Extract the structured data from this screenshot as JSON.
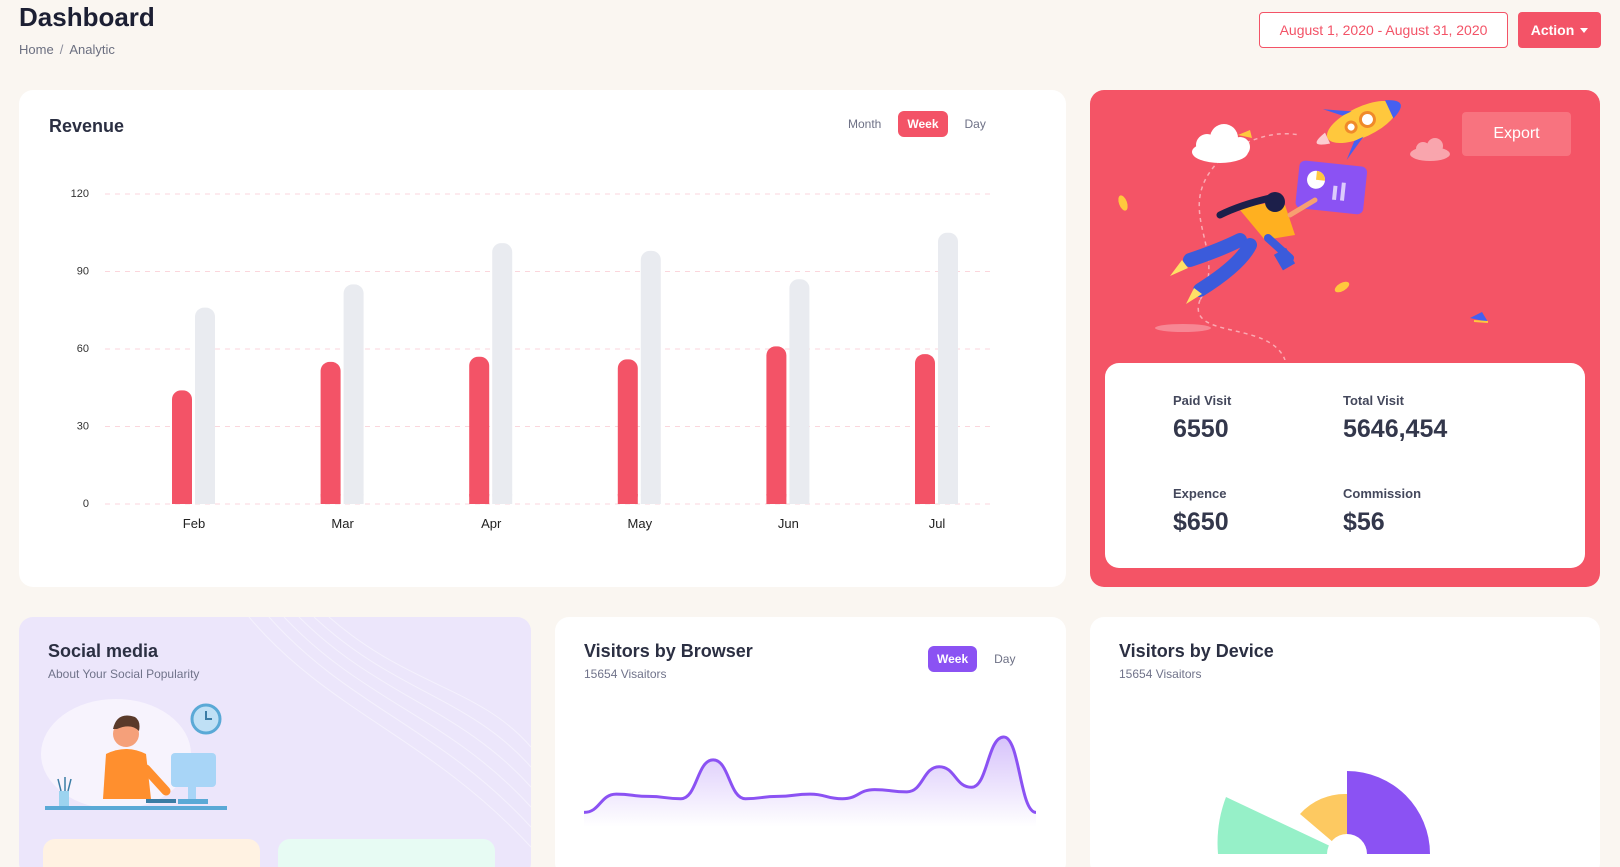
{
  "header": {
    "title": "Dashboard",
    "breadcrumb": [
      "Home",
      "Analytic"
    ],
    "breadcrumb_sep": "/",
    "date_range": "August 1, 2020 - August 31, 2020",
    "action_label": "Action"
  },
  "revenue": {
    "title": "Revenue",
    "tabs": [
      "Month",
      "Week",
      "Day"
    ],
    "active_tab": "Week"
  },
  "promo": {
    "export_label": "Export",
    "stats": [
      {
        "label": "Paid Visit",
        "value": "6550"
      },
      {
        "label": "Total Visit",
        "value": "5646,454"
      },
      {
        "label": "Expence",
        "value": "$650"
      },
      {
        "label": "Commission",
        "value": "$56"
      }
    ]
  },
  "social": {
    "title": "Social media",
    "subtitle": "About Your Social Popularity"
  },
  "browser": {
    "title": "Visitors by Browser",
    "subtitle": "15654 Visaitors",
    "tabs": [
      "Week",
      "Day"
    ],
    "active_tab": "Week"
  },
  "device": {
    "title": "Visitors by Device",
    "subtitle": "15654 Visaitors"
  },
  "colors": {
    "accent": "#f35367",
    "bar_gray": "#e9ebf0",
    "purple": "#8b52f3",
    "green": "#96f0c8",
    "yellow": "#fdc961"
  },
  "chart_data": [
    {
      "type": "bar",
      "title": "",
      "categories": [
        "Feb",
        "Mar",
        "Apr",
        "May",
        "Jun",
        "Jul"
      ],
      "series": [
        {
          "values": [
            44,
            55,
            57,
            56,
            61,
            58
          ]
        },
        {
          "values": [
            76,
            85,
            101,
            98,
            87,
            105
          ]
        }
      ],
      "ylim": [
        0,
        120
      ],
      "yticks": [
        0,
        30,
        60,
        90,
        120
      ],
      "grid": true
    },
    {
      "type": "area",
      "values": [
        2,
        10,
        9,
        8,
        25,
        8,
        9,
        10,
        8,
        12,
        11,
        22,
        13,
        35,
        2
      ]
    }
  ]
}
